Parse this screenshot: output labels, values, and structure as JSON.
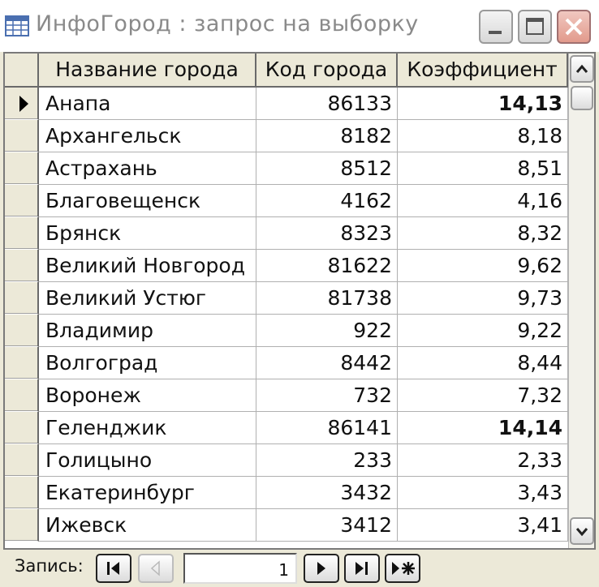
{
  "window": {
    "title": "ИнфоГород : запрос на выборку",
    "icon": "table-window-icon"
  },
  "table": {
    "columns": [
      "Название города",
      "Код города",
      "Коэффициент"
    ],
    "selected_index": 0,
    "rows": [
      {
        "name": "Анапа",
        "code": "86133",
        "coef": "14,13"
      },
      {
        "name": "Архангельск",
        "code": "8182",
        "coef": "8,18"
      },
      {
        "name": "Астрахань",
        "code": "8512",
        "coef": "8,51"
      },
      {
        "name": "Благовещенск",
        "code": "4162",
        "coef": "4,16"
      },
      {
        "name": "Брянск",
        "code": "8323",
        "coef": "8,32"
      },
      {
        "name": "Великий Новгород",
        "code": "81622",
        "coef": "9,62"
      },
      {
        "name": "Великий Устюг",
        "code": "81738",
        "coef": "9,73"
      },
      {
        "name": "Владимир",
        "code": "922",
        "coef": "9,22"
      },
      {
        "name": "Волгоград",
        "code": "8442",
        "coef": "8,44"
      },
      {
        "name": "Воронеж",
        "code": "732",
        "coef": "7,32"
      },
      {
        "name": "Геленджик",
        "code": "86141",
        "coef": "14,14"
      },
      {
        "name": "Голицыно",
        "code": "233",
        "coef": "2,33"
      },
      {
        "name": "Екатеринбург",
        "code": "3432",
        "coef": "3,43"
      },
      {
        "name": "Ижевск",
        "code": "3412",
        "coef": "3,41"
      }
    ]
  },
  "navigation": {
    "label": "Запись:",
    "record_value": "1"
  }
}
